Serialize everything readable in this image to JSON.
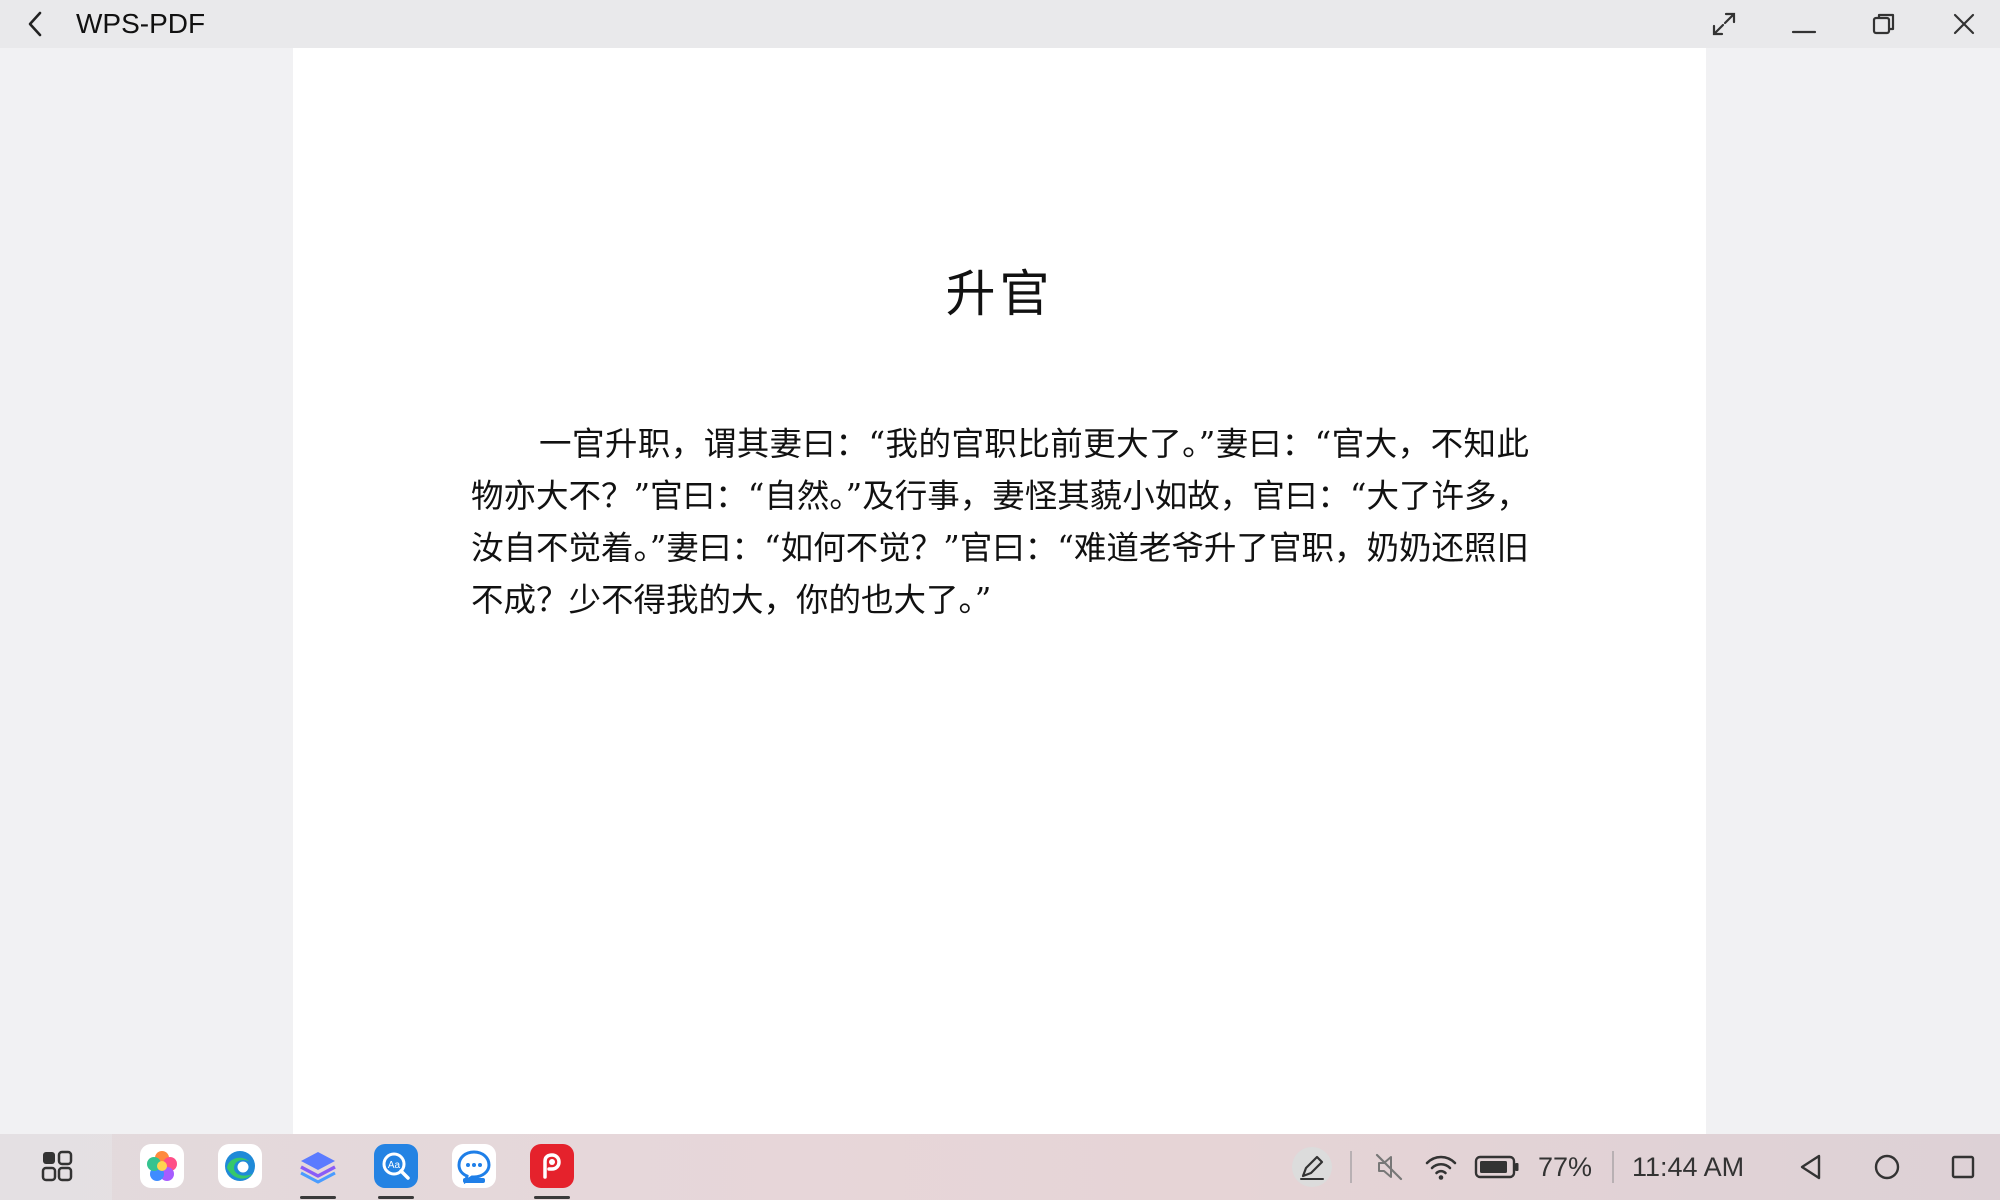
{
  "window": {
    "title": "WPS-PDF",
    "icons": [
      "back-chevron-icon",
      "expand-icon",
      "minimize-icon",
      "restore-icon",
      "close-icon"
    ]
  },
  "document": {
    "title": "升官",
    "body": "一官升职，谓其妻曰：“我的官职比前更大了。”妻曰：“官大，不知此物亦大不？”官曰：“自然。”及行事，妻怪其藐小如故，官曰：“大了许多，汝自不觉着。”妻曰：“如何不觉？”官曰：“难道老爷升了官职，奶奶还照旧不成？少不得我的大，你的也大了。”"
  },
  "taskbar": {
    "apps": [
      "app-drawer-icon",
      "gallery-icon",
      "edge-browser-icon",
      "layers-app-icon",
      "dictionary-app-icon",
      "chat-app-icon",
      "wps-pdf-icon"
    ],
    "battery_percent": "77%",
    "time": "11:44 AM",
    "colors": {
      "wps_red": "#e5222c",
      "edge_blue": "#1f8ad8",
      "dictionary_blue": "#2483e3"
    }
  }
}
